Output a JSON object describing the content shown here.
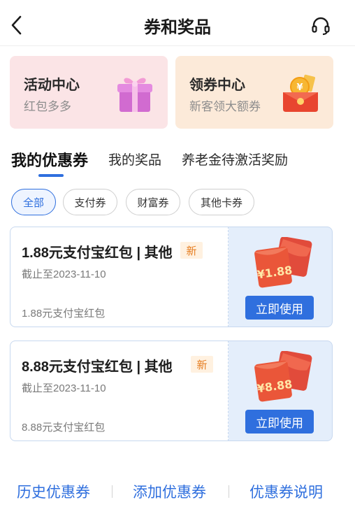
{
  "header": {
    "title": "券和奖品",
    "back_icon": "chevron-left-icon",
    "support_icon": "headset-icon"
  },
  "promos": [
    {
      "title": "活动中心",
      "subtitle": "红包多多",
      "icon": "gift-box-icon",
      "bg": "#fbe4e6"
    },
    {
      "title": "领券中心",
      "subtitle": "新客领大额券",
      "icon": "red-envelope-coin-icon",
      "bg": "#fcead9"
    }
  ],
  "tabs": [
    {
      "label": "我的优惠券",
      "active": true
    },
    {
      "label": "我的奖品",
      "active": false
    },
    {
      "label": "养老金待激活奖励",
      "active": false
    }
  ],
  "filters": [
    {
      "label": "全部",
      "active": true
    },
    {
      "label": "支付券",
      "active": false
    },
    {
      "label": "财富券",
      "active": false
    },
    {
      "label": "其他卡券",
      "active": false
    }
  ],
  "coupons": [
    {
      "name": "1.88元支付宝红包 | 其他",
      "badge": "新",
      "expire": "截止至2023-11-10",
      "desc": "1.88元支付宝红包",
      "amount_label": "¥1.88",
      "button": "立即使用"
    },
    {
      "name": "8.88元支付宝红包 | 其他",
      "badge": "新",
      "expire": "截止至2023-11-10",
      "desc": "8.88元支付宝红包",
      "amount_label": "¥8.88",
      "button": "立即使用"
    }
  ],
  "footer": {
    "links": [
      "历史优惠券",
      "添加优惠券",
      "优惠券说明"
    ]
  },
  "colors": {
    "accent": "#2f6fde",
    "badge_text": "#e67e22",
    "envelope_red": "#e8452f"
  }
}
